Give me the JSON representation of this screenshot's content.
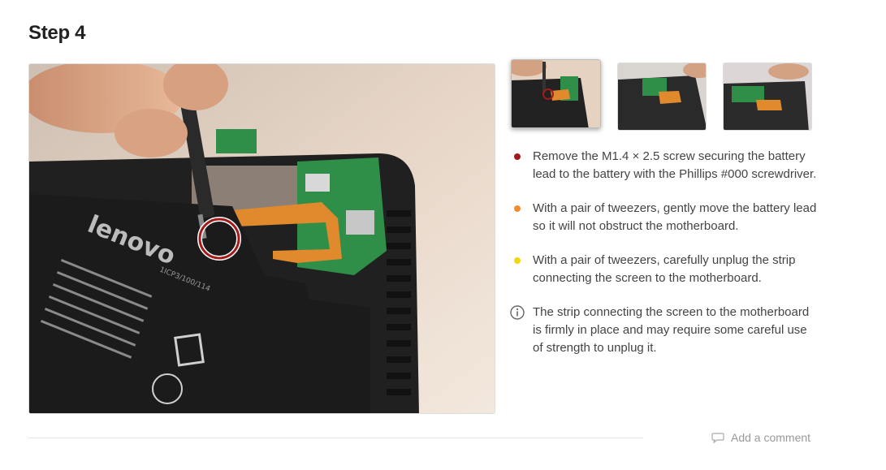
{
  "step": {
    "title": "Step 4"
  },
  "images": {
    "main_alt": "Removing battery lead screw from Lenovo tablet",
    "thumbnails": [
      {
        "alt": "Step 4 image 1",
        "active": true
      },
      {
        "alt": "Step 4 image 2",
        "active": false
      },
      {
        "alt": "Step 4 image 3",
        "active": false
      }
    ],
    "battery_text": "lenovo",
    "battery_label": "1ICP3/100/114"
  },
  "bullets": [
    {
      "color": "#a31a1a",
      "text": "Remove the M1.4 × 2.5 screw securing the battery lead to the battery with the Phillips #000 screwdriver."
    },
    {
      "color": "#f08c2b",
      "text": "With a pair of tweezers, gently move the battery lead so it will not obstruct the motherboard."
    },
    {
      "color": "#f2d60f",
      "text": "With a pair of tweezers, carefully unplug the strip connecting the screen to the motherboard."
    },
    {
      "icon": "info-icon",
      "text": "The strip connecting the screen to the motherboard is firmly in place and may require some careful use of strength to unplug it."
    }
  ],
  "comment": {
    "icon": "speech-bubble-icon",
    "label": "Add a comment"
  }
}
